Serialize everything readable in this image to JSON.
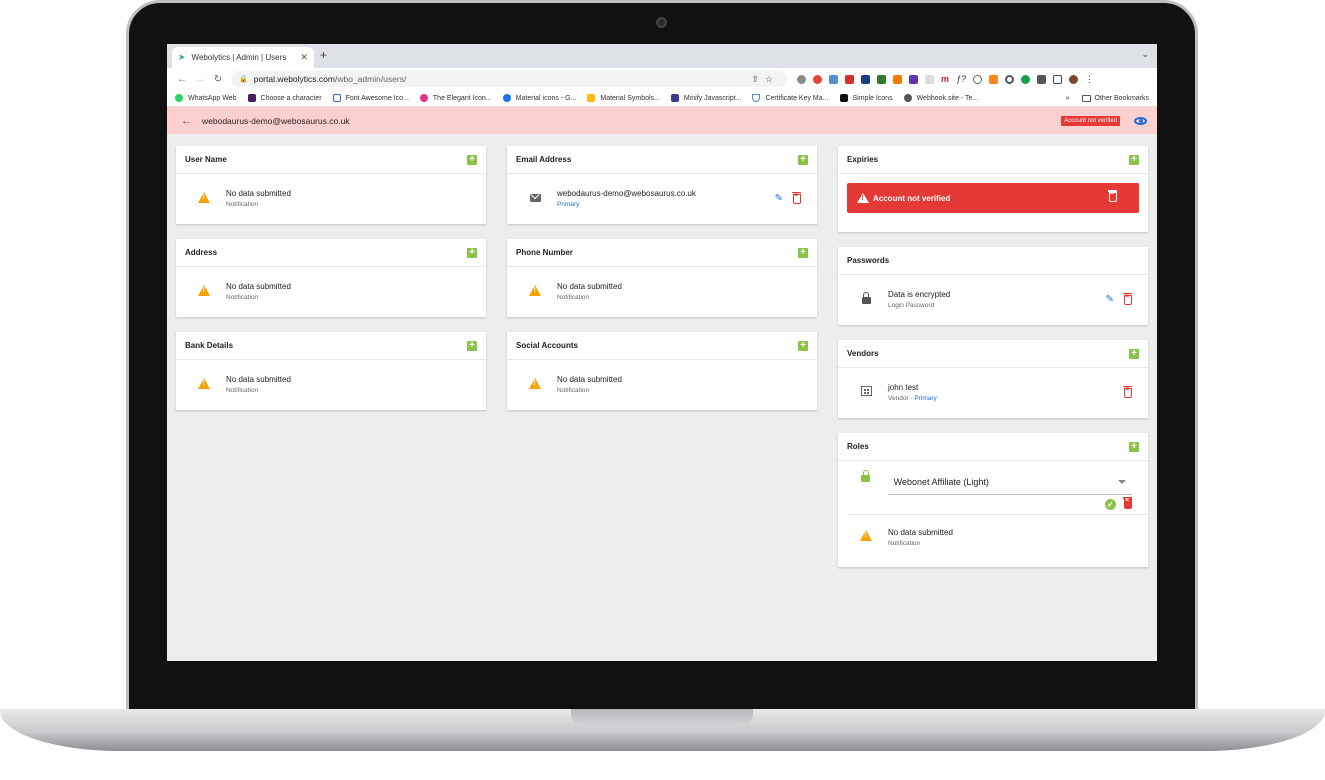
{
  "browser": {
    "tab_title": "Webolytics | Admin | Users",
    "url_host": "portal.webolytics.com",
    "url_path": "/wbo_admin/users/",
    "bookmarks": [
      {
        "label": "WhatsApp Web",
        "color": "#25d366"
      },
      {
        "label": "Choose a character",
        "color": "#4a1e5e"
      },
      {
        "label": "Font Awesome Ico...",
        "color": "#2b6cd8"
      },
      {
        "label": "The Elegant Icon...",
        "color": "#e0358b"
      },
      {
        "label": "Material icons - G...",
        "color": "#1a73e8"
      },
      {
        "label": "Material Symbols...",
        "color": "#fbbc04"
      },
      {
        "label": "Minify Javascript...",
        "color": "#3b3b8f"
      },
      {
        "label": "Certificate Key Ma...",
        "color": "#4b8ddb"
      },
      {
        "label": "Simple Icons",
        "color": "#111111"
      },
      {
        "label": "Webhook.site - Te...",
        "color": "#555555"
      }
    ],
    "more_bookmarks": "»",
    "other_bookmarks": "Other Bookmarks"
  },
  "header": {
    "email": "webodaurus-demo@webosaurus.co.uk",
    "status_badge": "Account not verified"
  },
  "cards": {
    "user_name": {
      "title": "User Name",
      "main": "No data submitted",
      "sub": "Notification"
    },
    "address": {
      "title": "Address",
      "main": "No data submitted",
      "sub": "Notification"
    },
    "bank_details": {
      "title": "Bank Details",
      "main": "No data submitted",
      "sub": "Notification"
    },
    "email_address": {
      "title": "Email Address",
      "main": "webodaurus-demo@webosaurus.co.uk",
      "sub": "Primary"
    },
    "phone_number": {
      "title": "Phone Number",
      "main": "No data submitted",
      "sub": "Notification"
    },
    "social_accounts": {
      "title": "Social Accounts",
      "main": "No data submitted",
      "sub": "Notification"
    },
    "expiries": {
      "title": "Expiries",
      "alert": "Account not verified"
    },
    "passwords": {
      "title": "Passwords",
      "main": "Data is encrypted",
      "sub": "Login Password"
    },
    "vendors": {
      "title": "Vendors",
      "main": "john test",
      "sub_prefix": "Vendor - ",
      "sub_link": "Primary"
    },
    "roles": {
      "title": "Roles",
      "selected_role": "Webonet Affiliate (Light)",
      "main": "No data submitted",
      "sub": "Notification"
    }
  },
  "colors": {
    "accent_green": "#8bc34a",
    "danger": "#e53935",
    "link_blue": "#1e6fd9",
    "warning": "#f5a300",
    "header_bg": "#fdd0d0"
  }
}
